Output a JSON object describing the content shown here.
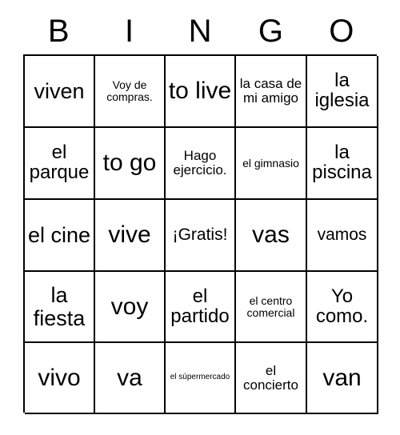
{
  "card": {
    "title": "BINGO",
    "header_letters": [
      "B",
      "I",
      "N",
      "G",
      "O"
    ],
    "grid_size": "5x5",
    "colors": {
      "background": "#ffffff",
      "border": "#000000",
      "text": "#000000"
    },
    "rows": [
      [
        {
          "text": "viven",
          "size": "fs-xl"
        },
        {
          "text": "Voy de compras.",
          "size": "fs-xs"
        },
        {
          "text": "to live",
          "size": "fs-xxl"
        },
        {
          "text": "la casa de mi amigo",
          "size": "fs-sm"
        },
        {
          "text": "la iglesia",
          "size": "fs-lg"
        }
      ],
      [
        {
          "text": "el parque",
          "size": "fs-lg"
        },
        {
          "text": "to go",
          "size": "fs-xxl"
        },
        {
          "text": "Hago ejercicio.",
          "size": "fs-sm"
        },
        {
          "text": "el gimnasio",
          "size": "fs-xs"
        },
        {
          "text": "la piscina",
          "size": "fs-lg"
        }
      ],
      [
        {
          "text": "el cine",
          "size": "fs-xl"
        },
        {
          "text": "vive",
          "size": "fs-xxl"
        },
        {
          "text": "¡Gratis!",
          "size": "fs-md"
        },
        {
          "text": "vas",
          "size": "fs-xxl"
        },
        {
          "text": "vamos",
          "size": "fs-md"
        }
      ],
      [
        {
          "text": "la fiesta",
          "size": "fs-xl"
        },
        {
          "text": "voy",
          "size": "fs-xxl"
        },
        {
          "text": "el partido",
          "size": "fs-lg"
        },
        {
          "text": "el centro comercial",
          "size": "fs-xs"
        },
        {
          "text": "Yo como.",
          "size": "fs-lg"
        }
      ],
      [
        {
          "text": "vivo",
          "size": "fs-xxl"
        },
        {
          "text": "va",
          "size": "fs-xxl"
        },
        {
          "text": "el súpermercado",
          "size": "fs-xxs"
        },
        {
          "text": "el concierto",
          "size": "fs-sm"
        },
        {
          "text": "van",
          "size": "fs-xxl"
        }
      ]
    ]
  }
}
